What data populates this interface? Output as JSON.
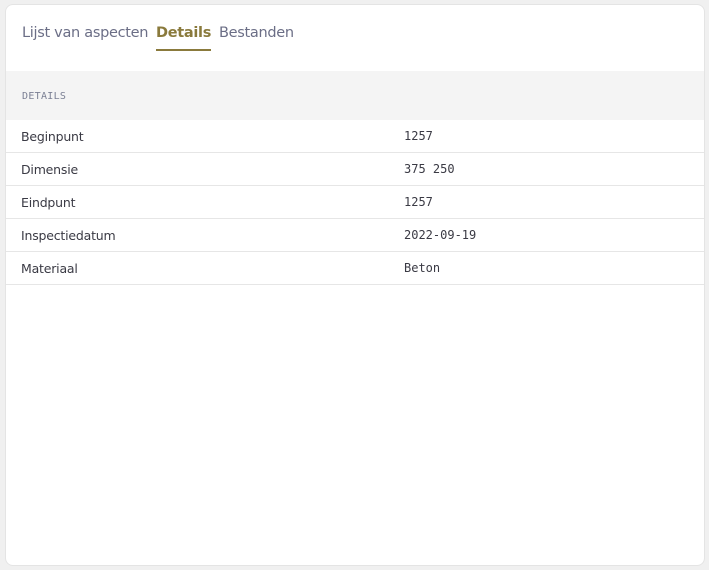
{
  "tabs": [
    {
      "label": "Lijst van aspecten",
      "active": false
    },
    {
      "label": "Details",
      "active": true
    },
    {
      "label": "Bestanden",
      "active": false
    }
  ],
  "section": {
    "title": "DETAILS"
  },
  "rows": [
    {
      "label": "Beginpunt",
      "value": "1257"
    },
    {
      "label": "Dimensie",
      "value": "375 250"
    },
    {
      "label": "Eindpunt",
      "value": "1257"
    },
    {
      "label": "Inspectiedatum",
      "value": "2022-09-19"
    },
    {
      "label": "Materiaal",
      "value": "Beton"
    }
  ],
  "colors": {
    "accent": "#8a7a3c",
    "tab_inactive": "#6b6e86",
    "header_bg": "#f4f4f4"
  }
}
